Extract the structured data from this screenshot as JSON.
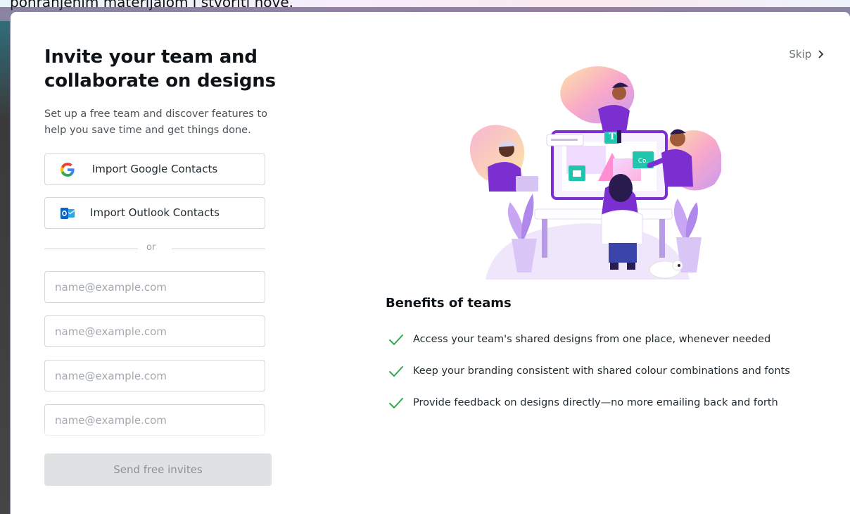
{
  "background": {
    "partial_text": "pohranjenim materijalom i stvoriti nove."
  },
  "modal": {
    "title": "Invite your team and collaborate on designs",
    "subtitle": "Set up a free team and discover features to help you save time and get things done.",
    "skip_label": "Skip",
    "skip_icon": "chevron-right-icon",
    "import_google": {
      "label": "Import Google Contacts",
      "icon": "google-icon"
    },
    "import_outlook": {
      "label": "Import Outlook Contacts",
      "icon": "outlook-icon"
    },
    "divider_text": "or",
    "email_inputs": [
      {
        "placeholder": "name@example.com",
        "value": ""
      },
      {
        "placeholder": "name@example.com",
        "value": ""
      },
      {
        "placeholder": "name@example.com",
        "value": ""
      },
      {
        "placeholder": "name@example.com",
        "value": ""
      }
    ],
    "send_button": "Send free invites",
    "benefits": {
      "title": "Benefits of teams",
      "items": [
        "Access your team's shared designs from one place, whenever needed",
        "Keep your branding consistent with shared colour combinations and fonts",
        "Provide feedback on designs directly—no more emailing back and forth"
      ]
    },
    "illustration": {
      "icon": "team-collaboration-illustration",
      "labels": {
        "text_tile": "T",
        "comment_tile": "Co."
      }
    }
  },
  "colors": {
    "check": "#2fa84f",
    "title": "#0e1318",
    "send_disabled_bg": "#dfe1e3",
    "purple_accent": "#7b2fd1"
  }
}
